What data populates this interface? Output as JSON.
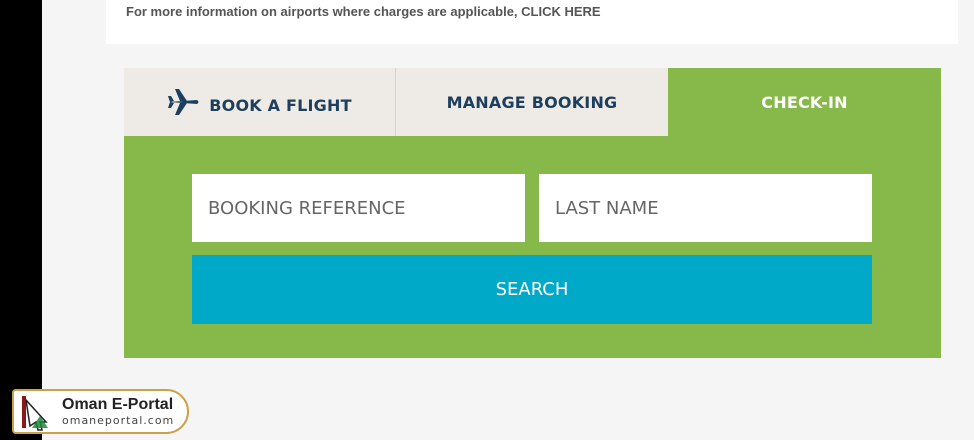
{
  "info": {
    "text": "For more information on airports where charges are applicable, CLICK HERE"
  },
  "tabs": [
    {
      "label": "BOOK A FLIGHT",
      "icon": "plane-icon"
    },
    {
      "label": "MANAGE BOOKING"
    },
    {
      "label": "CHECK-IN",
      "active": true
    }
  ],
  "form": {
    "booking_ref_placeholder": "BOOKING REFERENCE",
    "last_name_placeholder": "LAST NAME",
    "search_label": "SEARCH"
  },
  "logo": {
    "title": "Oman E-Portal",
    "url": "omaneportal.com"
  },
  "colors": {
    "green": "#86b94a",
    "navy": "#1d3f5e",
    "cyan": "#00a9c8",
    "tab_bg": "#eeeae5"
  }
}
